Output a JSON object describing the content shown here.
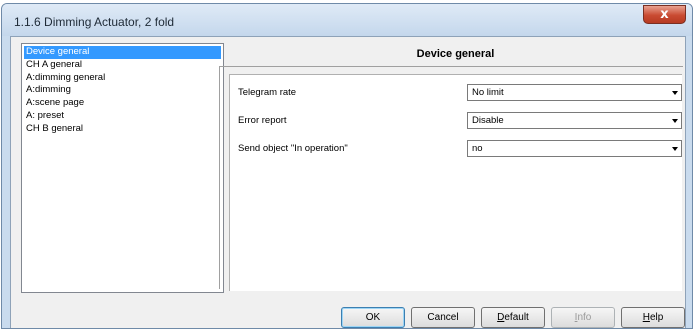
{
  "window": {
    "title": "1.1.6 Dimming Actuator, 2 fold",
    "close_glyph": "x"
  },
  "tree": {
    "items": [
      {
        "label": "Device general",
        "selected": true
      },
      {
        "label": "CH A general",
        "selected": false
      },
      {
        "label": "A:dimming general",
        "selected": false
      },
      {
        "label": "A:dimming",
        "selected": false
      },
      {
        "label": "A:scene page",
        "selected": false
      },
      {
        "label": "A: preset",
        "selected": false
      },
      {
        "label": "CH B general",
        "selected": false
      }
    ]
  },
  "panel": {
    "title": "Device general",
    "params": [
      {
        "label": "Telegram rate",
        "value": "No limit"
      },
      {
        "label": "Error report",
        "value": "Disable"
      },
      {
        "label": "Send object \"In operation\"",
        "value": "no"
      }
    ]
  },
  "buttons": {
    "ok": "OK",
    "cancel": "Cancel",
    "default_prefix": "",
    "default_key": "D",
    "default_rest": "efault",
    "info_key": "I",
    "info_rest": "nfo",
    "help_key": "H",
    "help_rest": "elp"
  },
  "colors": {
    "selection": "#3399ff",
    "close_button": "#c94b32",
    "titlebar": "#c9dbee"
  }
}
